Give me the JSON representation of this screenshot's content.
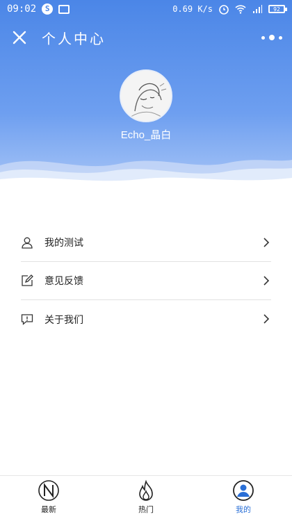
{
  "status_bar": {
    "time": "09:02",
    "network_speed": "0.69 K/s",
    "battery": "92"
  },
  "header": {
    "title": "个人中心"
  },
  "profile": {
    "username": "Echo_晶白"
  },
  "menu": {
    "items": [
      {
        "label": "我的测试",
        "icon": "user-icon"
      },
      {
        "label": "意见反馈",
        "icon": "edit-icon"
      },
      {
        "label": "关于我们",
        "icon": "message-alert-icon"
      }
    ]
  },
  "tabbar": {
    "tabs": [
      {
        "label": "最新",
        "icon": "n-circle-icon",
        "active": false
      },
      {
        "label": "热门",
        "icon": "flame-icon",
        "active": false
      },
      {
        "label": "我的",
        "icon": "profile-icon",
        "active": true
      }
    ]
  },
  "colors": {
    "header_gradient_top": "#4b86e7",
    "active_tab": "#2a6fd6"
  }
}
